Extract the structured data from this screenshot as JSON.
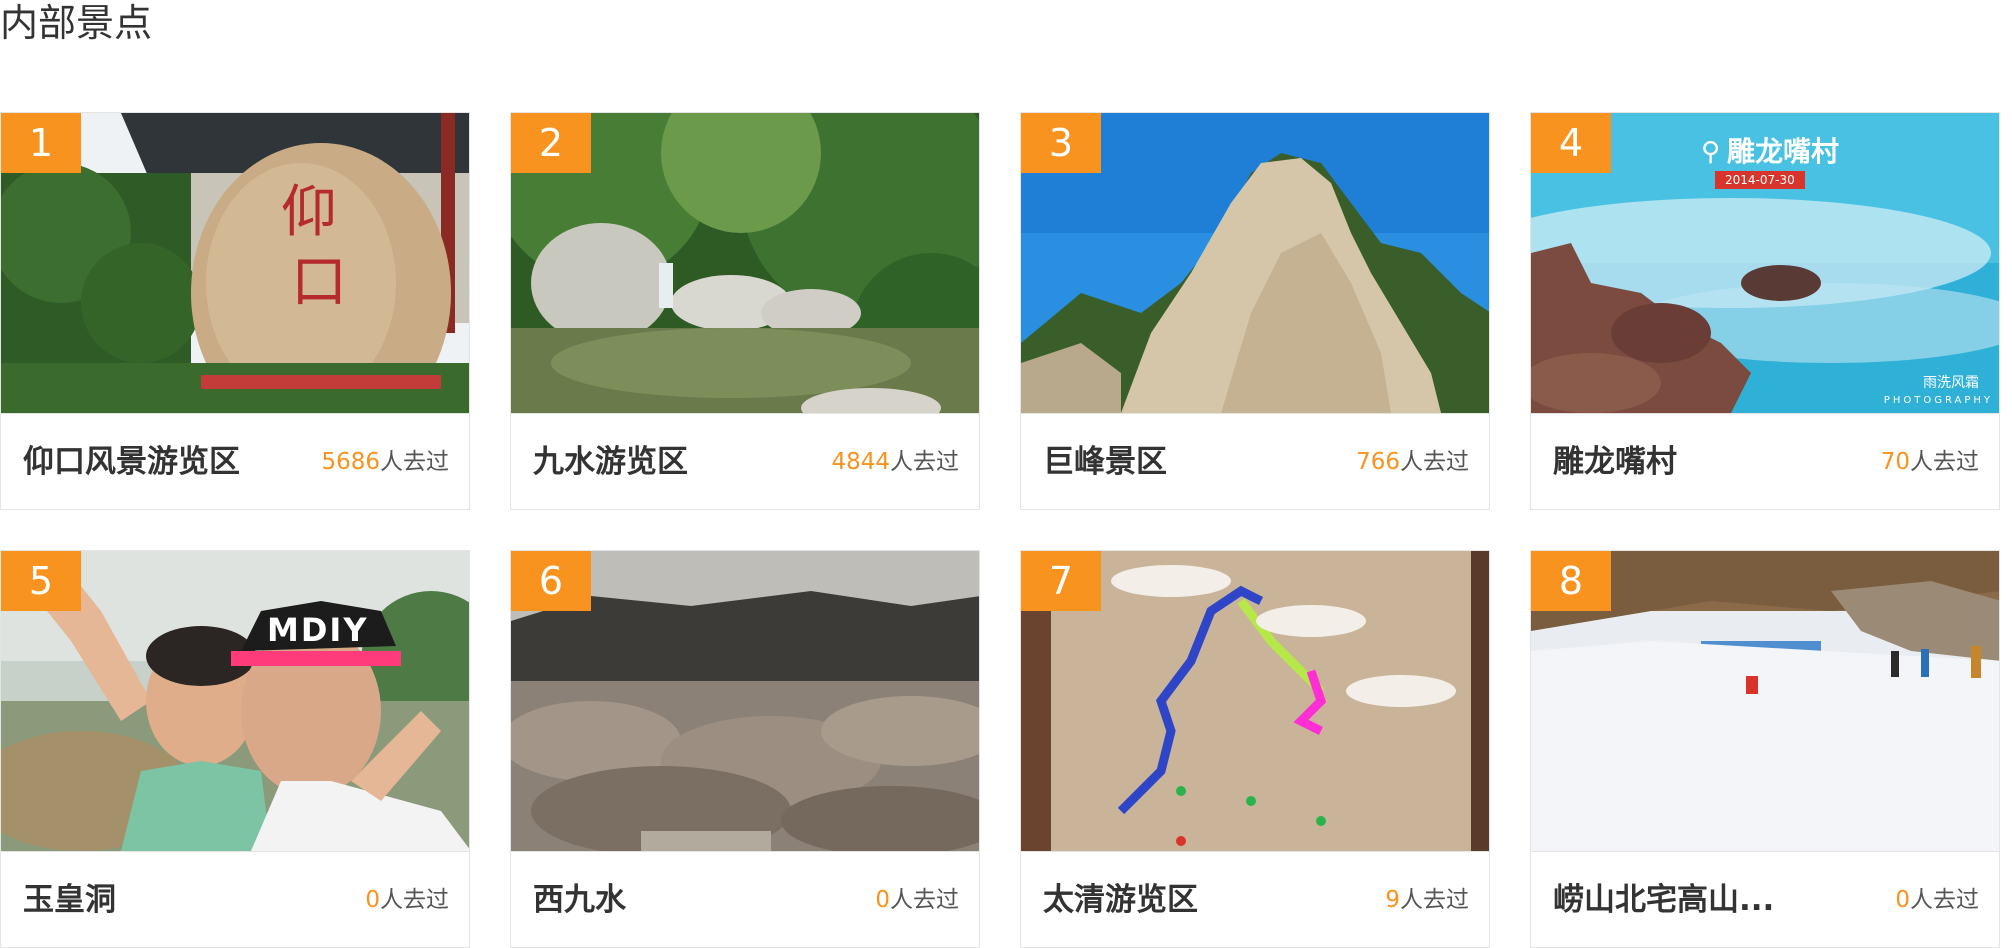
{
  "section_title": "内部景点",
  "colors": {
    "badge": "#f7931e",
    "count": "#f7931e",
    "border": "#e4e4e4"
  },
  "spots": [
    {
      "num": "1",
      "name": "仰口风景游览区",
      "count": "5686",
      "suffix": "人去过",
      "photo": "inscribed-boulder-photo"
    },
    {
      "num": "2",
      "name": "九水游览区",
      "count": "4844",
      "suffix": "人去过",
      "photo": "forest-pool-photo"
    },
    {
      "num": "3",
      "name": "巨峰景区",
      "count": "766",
      "suffix": "人去过",
      "photo": "rock-peak-photo"
    },
    {
      "num": "4",
      "name": "雕龙嘴村",
      "count": "70",
      "suffix": "人去过",
      "photo": "misty-sea-rocks-photo",
      "overlay_text": "雕龙嘴村",
      "overlay_date": "2014-07-30",
      "watermark": "雨洗风霜",
      "watermark_sub": "PHOTOGRAPHY"
    },
    {
      "num": "5",
      "name": "玉皇洞",
      "count": "0",
      "suffix": "人去过",
      "photo": "selfie-photo",
      "cap_text": "MDIY"
    },
    {
      "num": "6",
      "name": "西九水",
      "count": "0",
      "suffix": "人去过",
      "photo": "blossom-hillside-photo"
    },
    {
      "num": "7",
      "name": "太清游览区",
      "count": "9",
      "suffix": "人去过",
      "photo": "trail-map-board-photo"
    },
    {
      "num": "8",
      "name": "崂山北宅高山...",
      "count": "0",
      "suffix": "人去过",
      "photo": "snow-slope-photo"
    }
  ]
}
